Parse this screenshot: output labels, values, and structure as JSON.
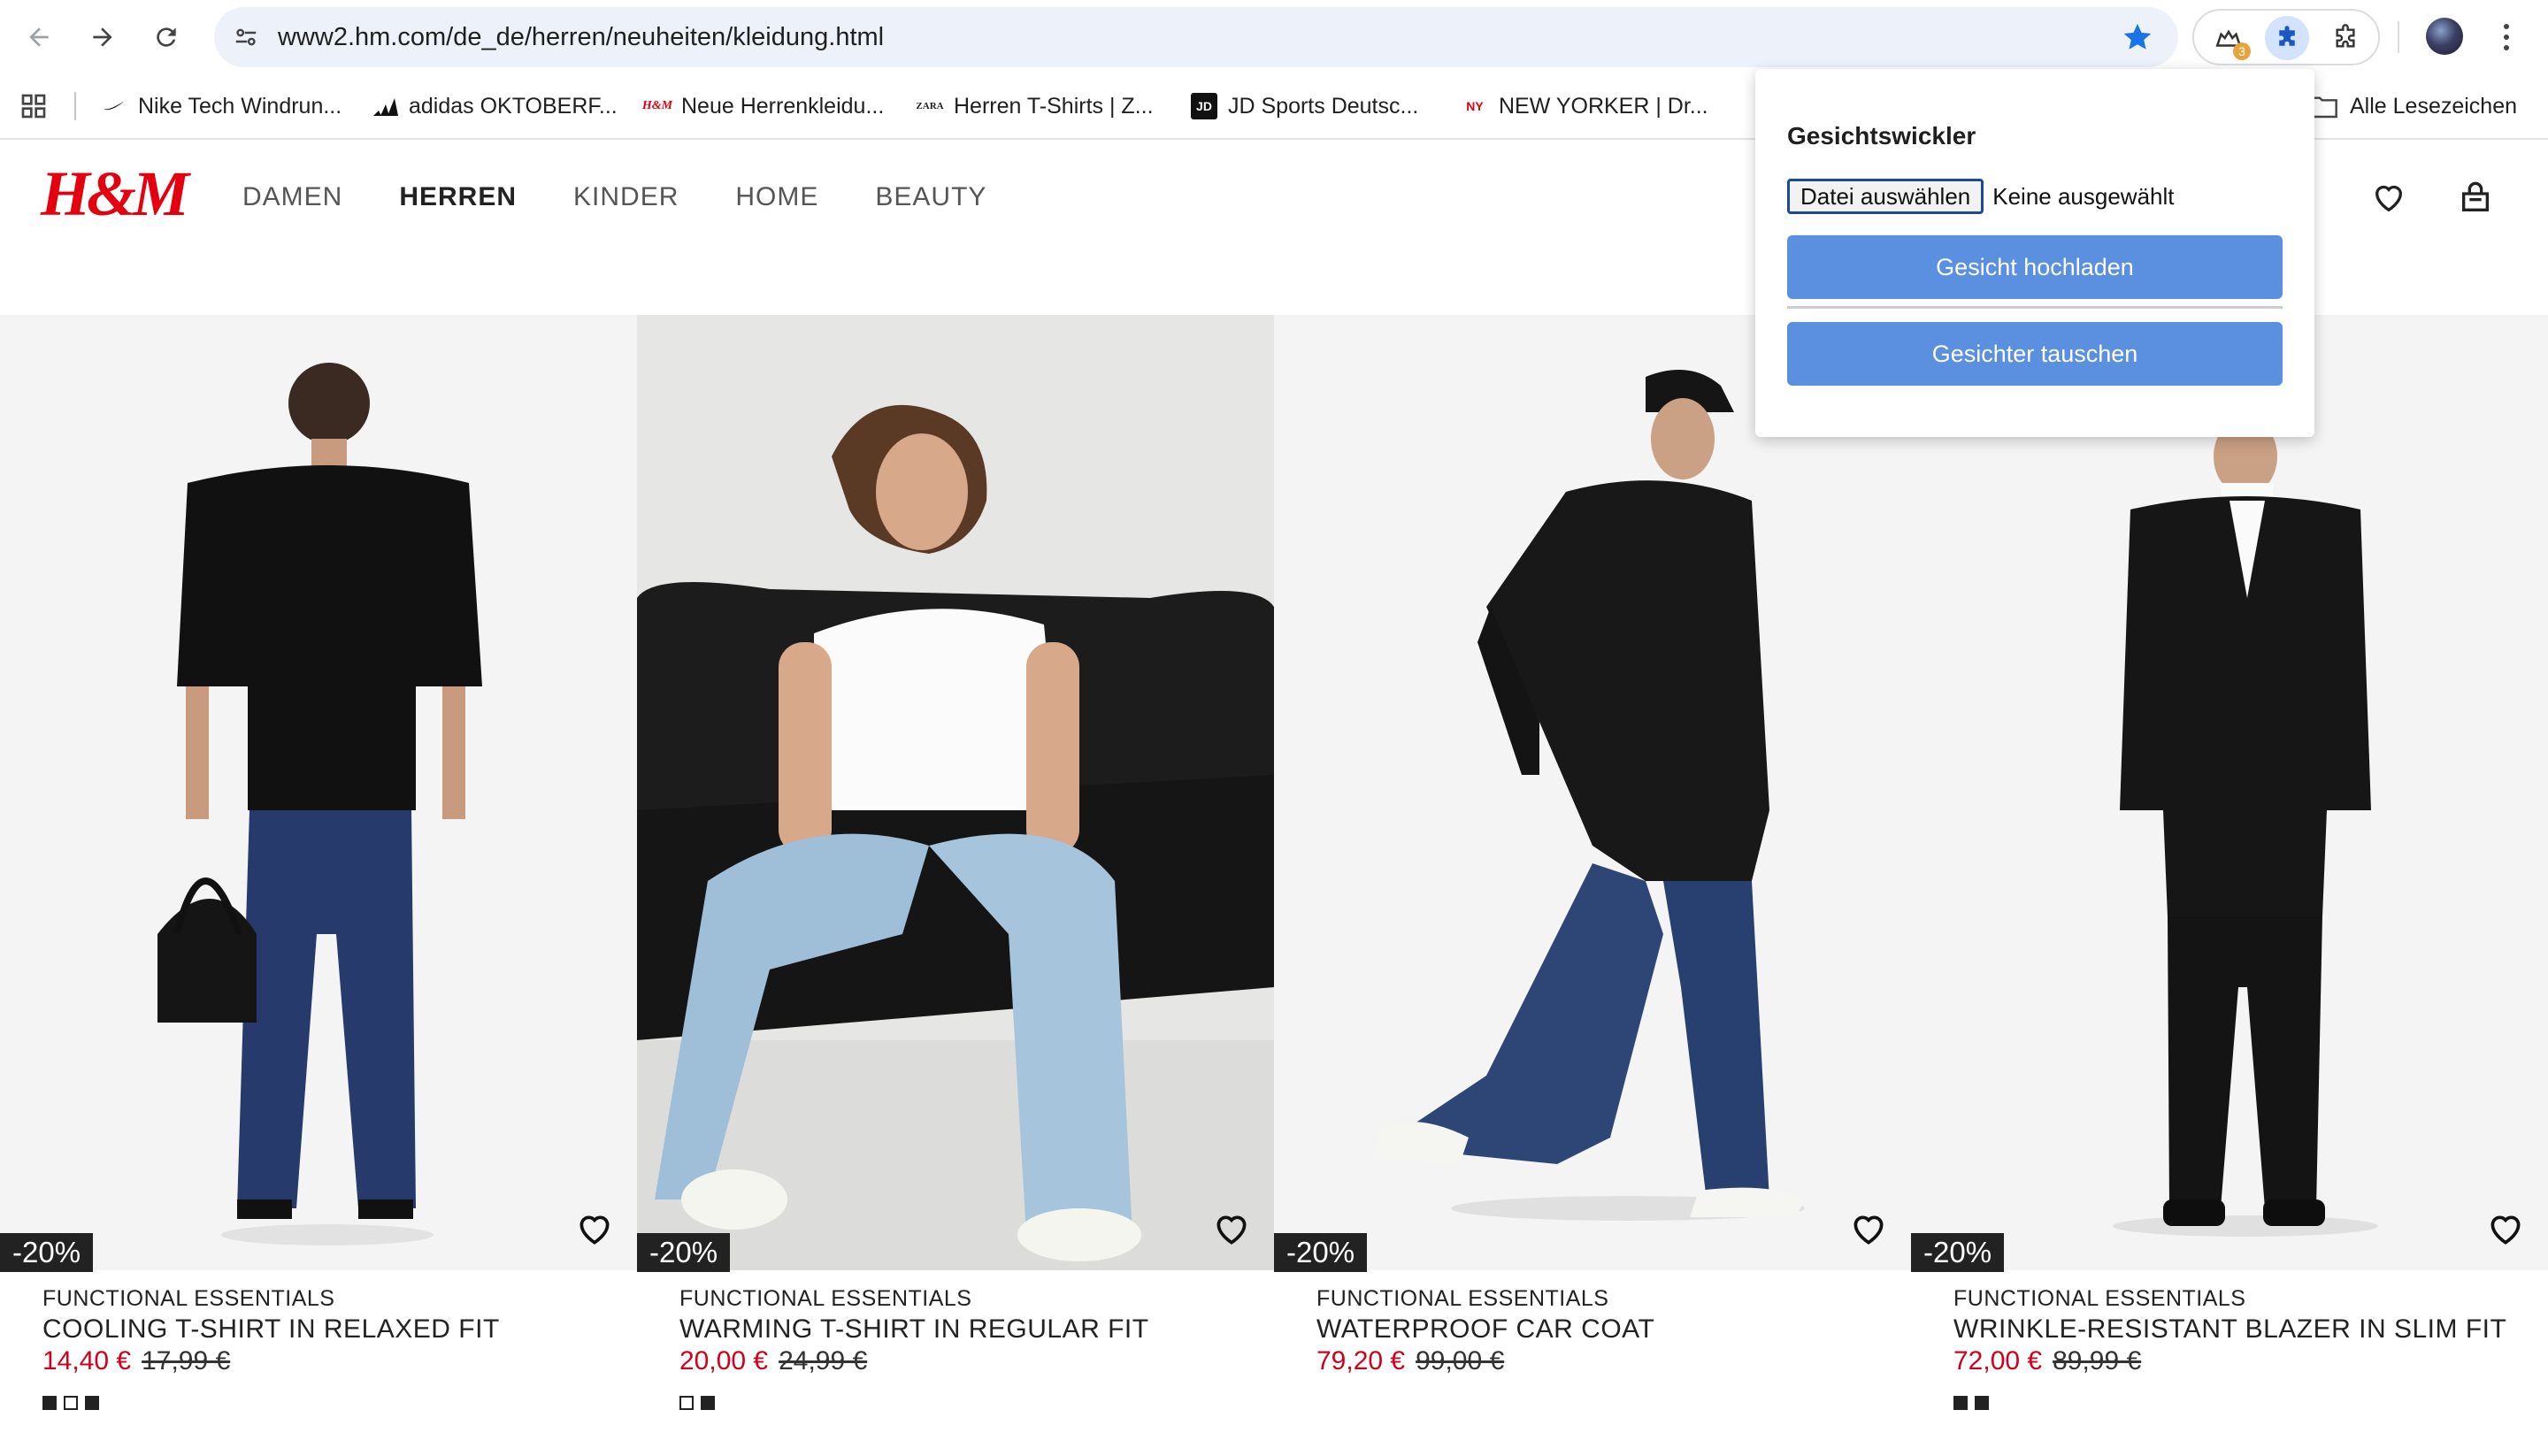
{
  "browser": {
    "url": "www2.hm.com/de_de/herren/neuheiten/kleidung.html",
    "extension_badge": "3",
    "bookmarks": [
      {
        "label": "Nike Tech Windrun...",
        "icon": "nike-swoosh-icon"
      },
      {
        "label": "adidas OKTOBERF...",
        "icon": "adidas-icon"
      },
      {
        "label": "Neue Herrenkleidu...",
        "icon": "hm-icon"
      },
      {
        "label": "Herren T-Shirts | Z...",
        "icon": "zara-icon"
      },
      {
        "label": "JD Sports Deutsc...",
        "icon": "jd-icon"
      },
      {
        "label": "NEW YORKER | Dr...",
        "icon": "newyorker-icon"
      }
    ],
    "all_bookmarks": "Alle Lesezeichen",
    "bookmark_icon_text": {
      "hm": "H&M",
      "zara": "ZARA",
      "jd": "JD",
      "newyorker": "NY"
    }
  },
  "site": {
    "logo": "H&M",
    "brand_color": "#e50010",
    "nav": [
      "DAMEN",
      "HERREN",
      "KINDER",
      "HOME",
      "BEAUTY"
    ],
    "active_nav": "HERREN"
  },
  "products": [
    {
      "discount": "-20%",
      "brand": "FUNCTIONAL ESSENTIALS",
      "title": "COOLING T-SHIRT IN RELAXED FIT",
      "price": "14,40 €",
      "old_price": "17,99 €",
      "swatches": [
        "#222222",
        "#ffffff",
        "#222222"
      ]
    },
    {
      "discount": "-20%",
      "brand": "FUNCTIONAL ESSENTIALS",
      "title": "WARMING T-SHIRT IN REGULAR FIT",
      "price": "20,00 €",
      "old_price": "24,99 €",
      "swatches": [
        "#ffffff",
        "#222222"
      ]
    },
    {
      "discount": "-20%",
      "brand": "FUNCTIONAL ESSENTIALS",
      "title": "WATERPROOF CAR COAT",
      "price": "79,20 €",
      "old_price": "99,00 €",
      "swatches": []
    },
    {
      "discount": "-20%",
      "brand": "FUNCTIONAL ESSENTIALS",
      "title": "WRINKLE-RESISTANT BLAZER IN SLIM FIT",
      "price": "72,00 €",
      "old_price": "89,99 €",
      "swatches": [
        "#222222",
        "#222222"
      ]
    }
  ],
  "popup": {
    "title": "Gesichtswickler",
    "file_button": "Datei auswählen",
    "file_status": "Keine ausgewählt",
    "upload_button": "Gesicht hochladen",
    "swap_button": "Gesichter tauschen",
    "button_color": "#5b8fdf"
  }
}
